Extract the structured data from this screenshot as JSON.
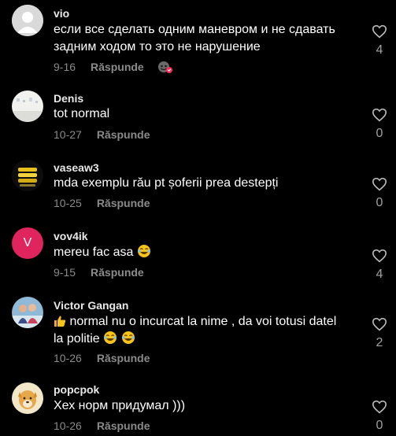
{
  "comments": [
    {
      "username": "vio",
      "text": "если все сделать одним маневром и не сдавать задним ходом то это не нарушение",
      "date": "9-16",
      "reply_label": "Răspunde",
      "likes": "4",
      "avatar": "default-gray-avatar"
    },
    {
      "username": "Denis",
      "text": "tot normal",
      "date": "10-27",
      "reply_label": "Răspunde",
      "likes": "0",
      "avatar": "photo-avatar-light"
    },
    {
      "username": "vaseaw3",
      "text": "mda exemplu rău pt șoferii prea destepți",
      "date": "10-25",
      "reply_label": "Răspunde",
      "likes": "0",
      "avatar": "photo-avatar-yellow"
    },
    {
      "username": "vov4ik",
      "text": "mereu fac asa",
      "date": "9-15",
      "reply_label": "Răspunde",
      "likes": "4",
      "avatar": "letter-avatar",
      "avatar_letter": "V"
    },
    {
      "username": "Victor Gangan",
      "text_part1": "normal nu o incurcat la nime , da voi totusi datel",
      "text_part2": "la politie",
      "date": "10-26",
      "reply_label": "Răspunde",
      "likes": "2",
      "avatar": "photo-avatar-couple"
    },
    {
      "username": "popcpok",
      "text": "Хех норм придумал )))",
      "date": "10-26",
      "reply_label": "Răspunde",
      "likes": "0",
      "avatar": "photo-avatar-dog"
    }
  ],
  "colors": {
    "background": "#000000",
    "username": "#e8e8e8",
    "meta": "#8a8a8a",
    "letter_avatar": "#e0245e"
  }
}
